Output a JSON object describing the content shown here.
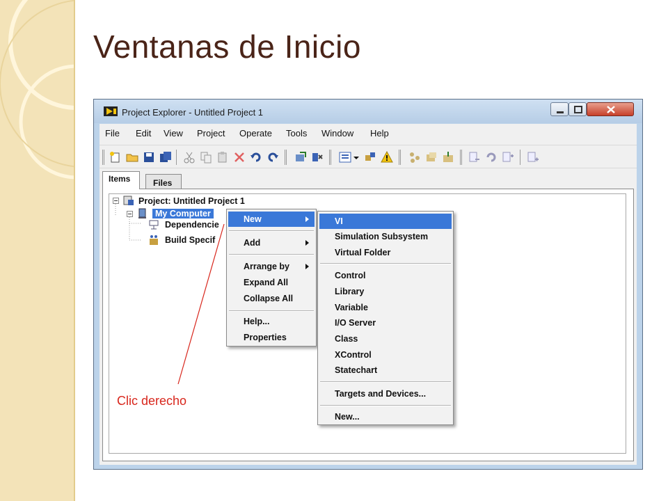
{
  "slide": {
    "title": "Ventanas de Inicio"
  },
  "window": {
    "title": "Project Explorer - Untitled Project 1"
  },
  "menubar": {
    "items": [
      "File",
      "Edit",
      "View",
      "Project",
      "Operate",
      "Tools",
      "Window",
      "Help"
    ]
  },
  "tabs": {
    "items_label": "Items",
    "files_label": "Files"
  },
  "tree": {
    "project": "Project: Untitled Project 1",
    "my_computer": "My Computer",
    "dependencies": "Dependencie",
    "build_specs": "Build Specif"
  },
  "context_menu": {
    "items": [
      "New",
      "Add",
      "Arrange by",
      "Expand All",
      "Collapse All",
      "Help...",
      "Properties"
    ]
  },
  "new_submenu": {
    "items": [
      "VI",
      "Simulation Subsystem",
      "Virtual Folder",
      "Control",
      "Library",
      "Variable",
      "I/O Server",
      "Class",
      "XControl",
      "Statechart",
      "Targets and Devices...",
      "New..."
    ]
  },
  "annotation": {
    "text": "Clic derecho",
    "color": "#d8261c"
  },
  "colors": {
    "title": "#4a2418",
    "selection": "#3a78d8",
    "band": "#f3e3b8"
  }
}
